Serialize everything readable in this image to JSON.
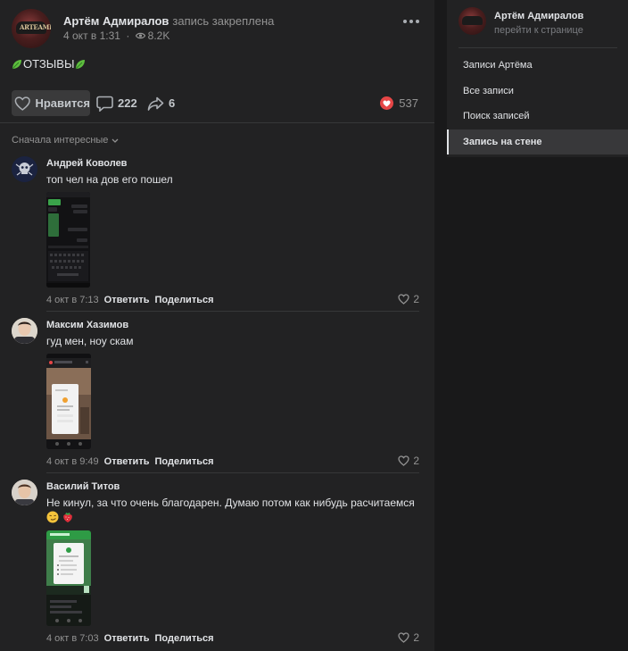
{
  "post": {
    "author": "Артём Адмиралов",
    "status": "запись закреплена",
    "date": "4 окт в 1:31",
    "views": "8.2K",
    "avatar_text": "ARTEAMRAN",
    "text": "ОТЗЫВЫ",
    "like_label": "Нравится",
    "comments_count": "222",
    "shares_count": "6",
    "reactions_count": "537"
  },
  "sort_label": "Сначала интересные",
  "comments": [
    {
      "author": "Андрей Коволев",
      "text": "топ чел на дов его пошел",
      "text2": "",
      "date": "4 окт в 7:13",
      "reply": "Ответить",
      "share": "Поделиться",
      "likes": "2"
    },
    {
      "author": "Максим Хазимов",
      "text": "гуд мен, ноу скам",
      "text2": "",
      "date": "4 окт в 9:49",
      "reply": "Ответить",
      "share": "Поделиться",
      "likes": "2"
    },
    {
      "author": "Василий Титов",
      "text": "Не кинул, за что очень благодарен. Думаю потом как нибудь расчитаемся",
      "text2": "",
      "date": "4 окт в 7:03",
      "reply": "Ответить",
      "share": "Поделиться",
      "likes": "2"
    }
  ],
  "sidebar": {
    "name": "Артём Адмиралов",
    "subtitle": "перейти к странице",
    "items": [
      {
        "label": "Записи Артёма",
        "active": false
      },
      {
        "label": "Все записи",
        "active": false
      },
      {
        "label": "Поиск записей",
        "active": false
      },
      {
        "label": "Запись на стене",
        "active": true
      }
    ]
  },
  "colors": {
    "background": "#19191a",
    "panel": "#222223",
    "text": "#e1e3e6",
    "secondary": "#939393",
    "reaction_heart": "#e64646"
  }
}
